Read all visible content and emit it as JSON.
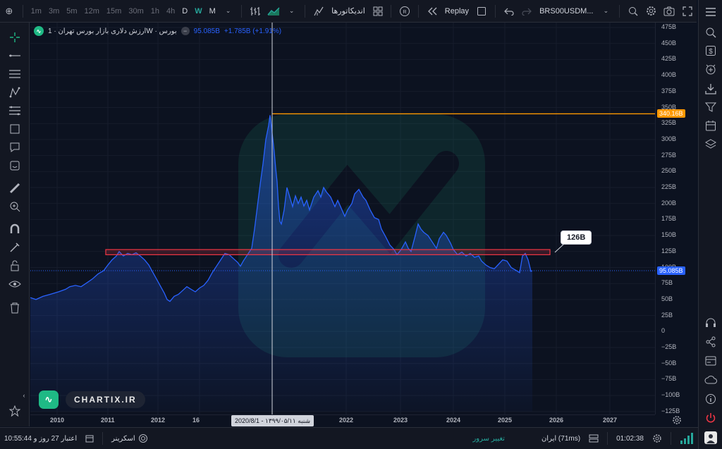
{
  "toolbar": {
    "intervals": [
      "1m",
      "3m",
      "5m",
      "12m",
      "15m",
      "30m",
      "1h",
      "4h",
      "D",
      "W",
      "M"
    ],
    "active_interval": "W",
    "indicators_label": "اندیکاتورها",
    "replay_label": "Replay",
    "symbol": "BRS00USDM...",
    "icons": [
      "plus-icon",
      "bar-style-icon",
      "area-style-icon",
      "indicators-icon",
      "layout-icon",
      "replay-r-icon",
      "undo-icon",
      "redo-icon",
      "quick-search-icon",
      "settings-icon",
      "camera-icon",
      "fullscreen-icon"
    ]
  },
  "legend": {
    "title": "ارزش دلاری بازار بورس تهران · 1W · بورس",
    "value": "95.085B",
    "change": "+1.785B (+1.91%)"
  },
  "y_axis": {
    "ticks": [
      "475B",
      "450B",
      "425B",
      "400B",
      "375B",
      "350B",
      "325B",
      "300B",
      "275B",
      "250B",
      "225B",
      "200B",
      "175B",
      "150B",
      "125B",
      "100B",
      "75B",
      "50B",
      "25B",
      "0",
      "−25B",
      "−50B",
      "−75B",
      "−100B",
      "−125B"
    ],
    "price_tag_orange": "340.16B",
    "price_tag_blue": "95.085B"
  },
  "x_axis": {
    "ticks": [
      "2010",
      "2011",
      "2012",
      "16",
      "2022",
      "2023",
      "2024",
      "2025",
      "2026",
      "2027"
    ],
    "crosshair_label": "شنبه ۱۳۹۹/۰۵/۱۱ - 2020/8/1"
  },
  "annotation": {
    "callout": "126B"
  },
  "watermark": {
    "text": "CHARTIX.IR"
  },
  "bottom": {
    "date_range": "10:55:44 اعتبار 27 روز و",
    "screener": "اسکرینر",
    "server_change": "تغییر سرور",
    "server": "ایران (71ms)",
    "clock": "01:02:38"
  },
  "colors": {
    "line": "#2962ff",
    "horizontal_level": "#ff9800",
    "zone": "#f23645",
    "accent_green": "#1fb985"
  }
}
